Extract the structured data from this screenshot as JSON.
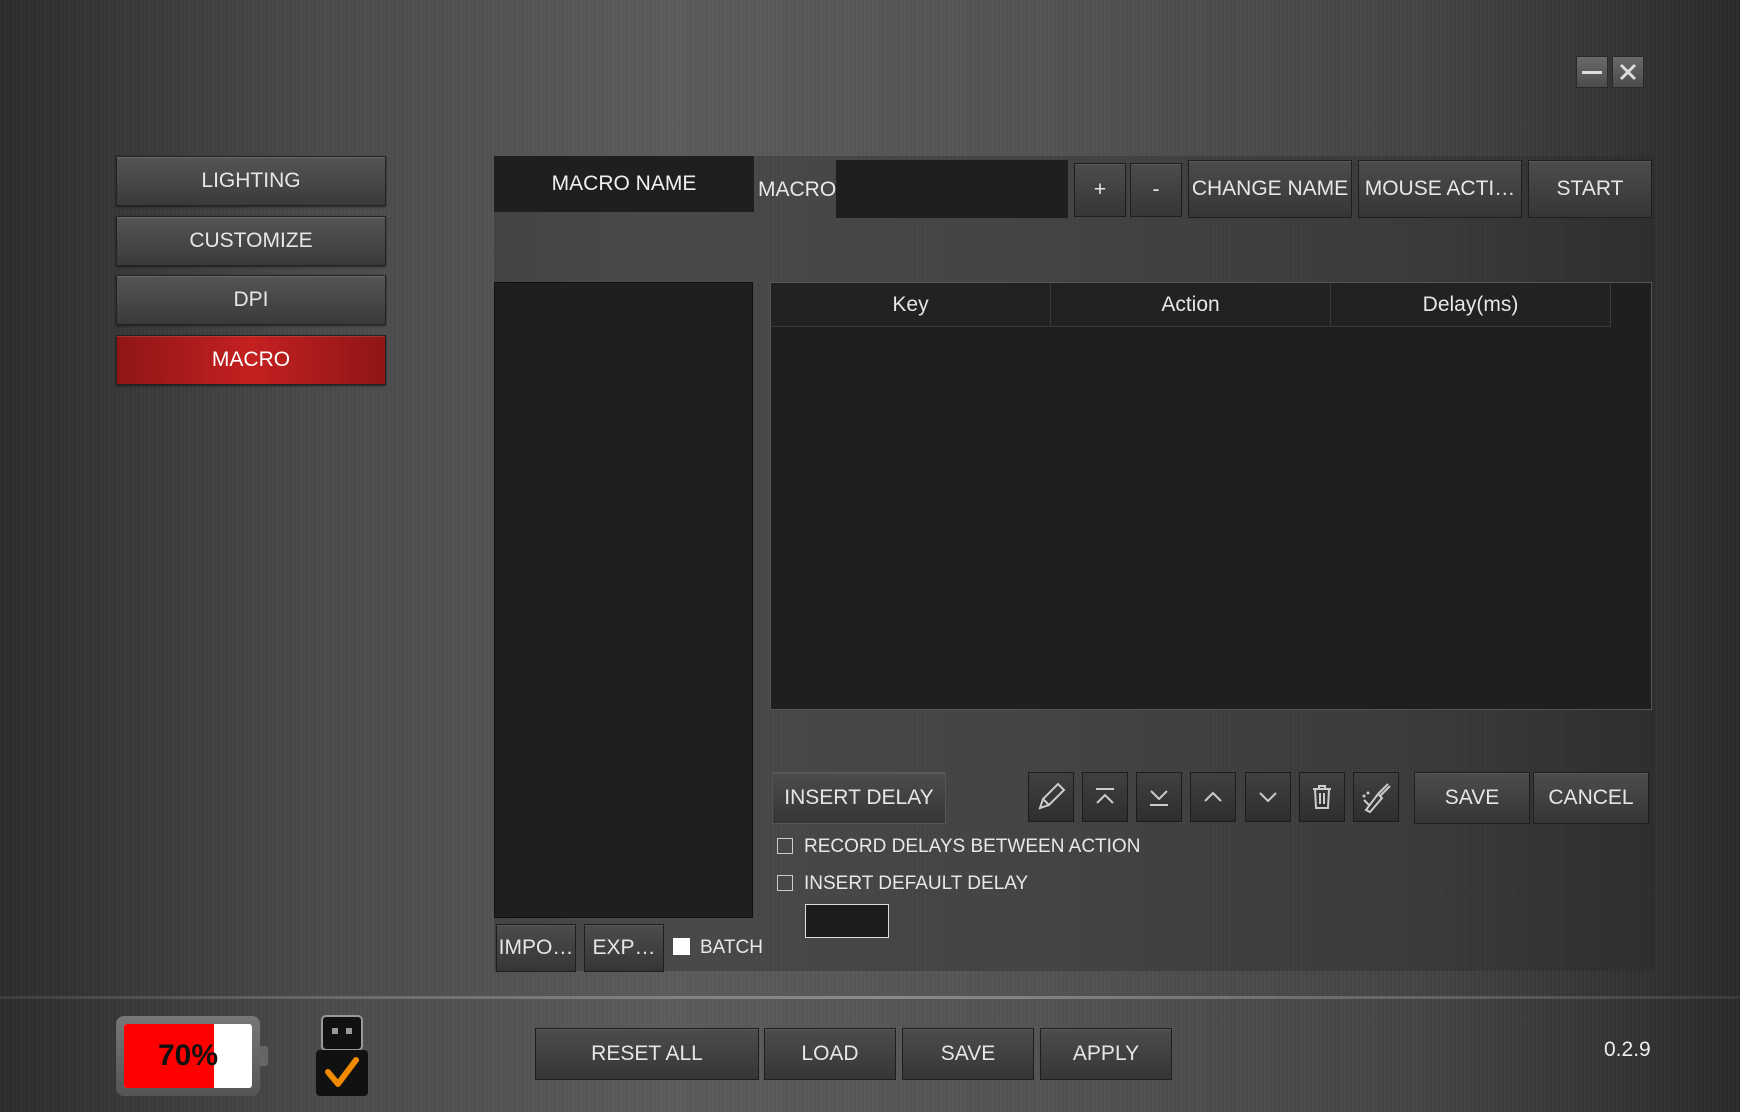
{
  "window": {
    "minimize_icon": "minimize-icon",
    "close_icon": "close-icon"
  },
  "nav": {
    "items": [
      {
        "label": "LIGHTING"
      },
      {
        "label": "CUSTOMIZE"
      },
      {
        "label": "DPI"
      },
      {
        "label": "MACRO"
      }
    ],
    "active": "MACRO"
  },
  "macro": {
    "name_header": "MACRO NAME",
    "macro_label": "MACRO",
    "macro_value": "",
    "add_label": "+",
    "remove_label": "-",
    "change_name_label": "CHANGE NAME",
    "mouse_action_label": "MOUSE ACTI…",
    "start_label": "START",
    "table": {
      "columns": [
        "Key",
        "Action",
        "Delay(ms)"
      ],
      "rows": []
    },
    "insert_delay_label": "INSERT DELAY",
    "toolbar_icons": [
      "edit-pencil-icon",
      "move-top-icon",
      "move-bottom-icon",
      "move-up-icon",
      "move-down-icon",
      "trash-icon",
      "clear-all-brush-icon"
    ],
    "save_label": "SAVE",
    "cancel_label": "CANCEL",
    "record_delays_label": "RECORD DELAYS BETWEEN ACTION",
    "record_delays_checked": false,
    "insert_default_delay_label": "INSERT DEFAULT DELAY",
    "insert_default_delay_checked": false,
    "default_delay_value": "",
    "import_label": "IMPO…",
    "export_label": "EXP…",
    "batch_label": "BATCH",
    "batch_checked": false
  },
  "footer": {
    "battery_percent": "70%",
    "battery_level": 0.7,
    "reset_all_label": "RESET ALL",
    "load_label": "LOAD",
    "save_label": "SAVE",
    "apply_label": "APPLY",
    "version": "0.2.9"
  },
  "colors": {
    "accent_red": "#c42020",
    "check_orange": "#f08a00",
    "battery_red": "#ff0000"
  }
}
